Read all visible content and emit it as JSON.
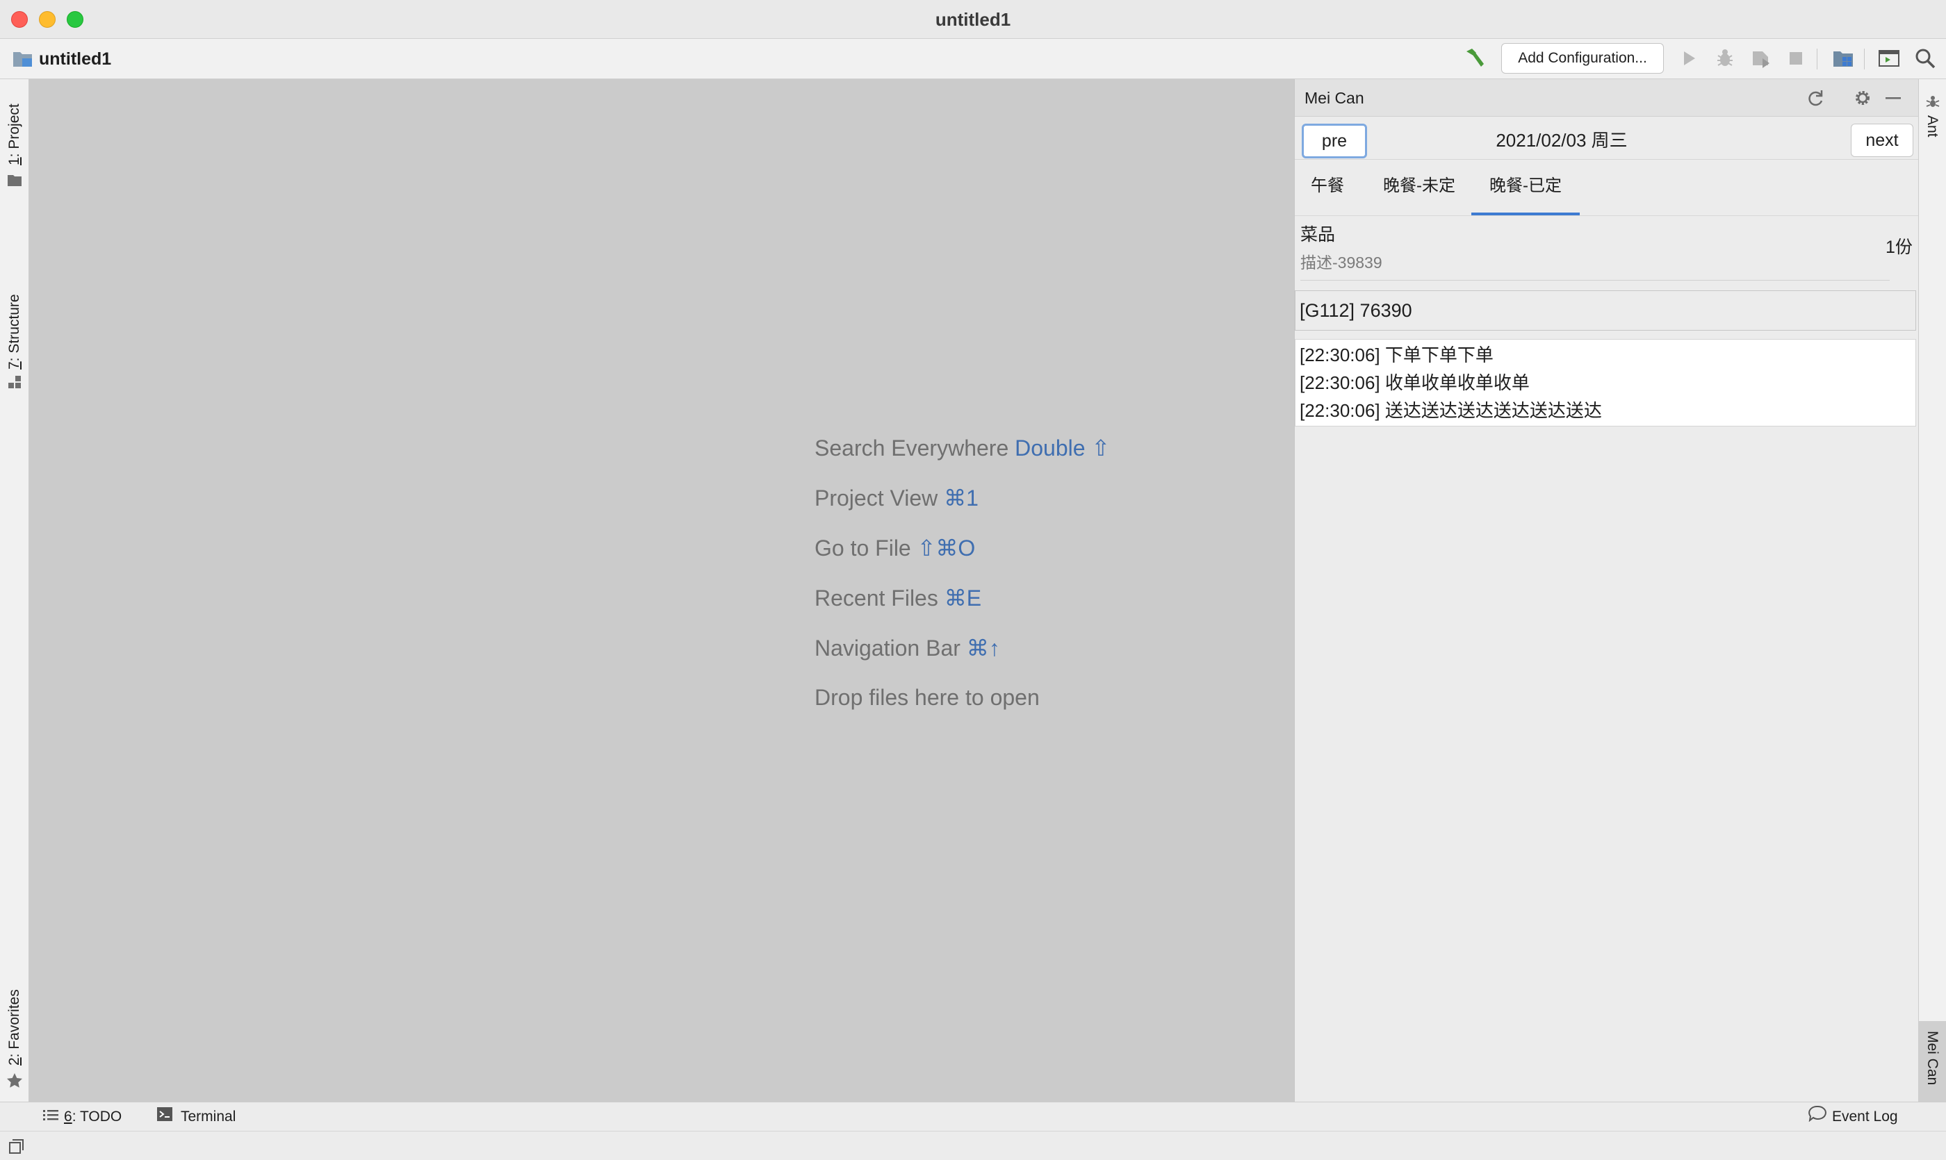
{
  "window": {
    "title": "untitled1"
  },
  "toolbar": {
    "project_name": "untitled1",
    "add_configuration_label": "Add Configuration...",
    "icons": [
      "hammer-icon",
      "run-icon",
      "debug-icon",
      "coverage-icon",
      "stop-icon",
      "project-structure-icon",
      "presentation-icon",
      "search-icon"
    ]
  },
  "left_stripe": {
    "tabs": [
      {
        "mnemonic": "1",
        "label": ": Project"
      },
      {
        "mnemonic": "7",
        "label": ": Structure"
      },
      {
        "mnemonic": "2",
        "label": ": Favorites"
      }
    ]
  },
  "editor": {
    "hints": [
      {
        "text": "Search Everywhere ",
        "shortcut": "Double ⇧"
      },
      {
        "text": "Project View ",
        "shortcut": "⌘1"
      },
      {
        "text": "Go to File ",
        "shortcut": "⇧⌘O"
      },
      {
        "text": "Recent Files ",
        "shortcut": "⌘E"
      },
      {
        "text": "Navigation Bar ",
        "shortcut": "⌘↑"
      },
      {
        "text": "Drop files here to open",
        "shortcut": ""
      }
    ]
  },
  "meican": {
    "title": "Mei Can",
    "pre_label": "pre",
    "date": "2021/02/03 周三",
    "next_label": "next",
    "tabs": [
      "午餐",
      "晚餐-未定",
      "晚餐-已定"
    ],
    "active_tab": 2,
    "dish": {
      "name": "菜品",
      "description": "描述-39839",
      "quantity": "1份"
    },
    "order_code": "[G112] 76390",
    "log": [
      "[22:30:06] 下单下单下单",
      "[22:30:06] 收单收单收单收单",
      "[22:30:06] 送达送达送达送达送达送达"
    ]
  },
  "right_stripe": {
    "tabs": [
      "Ant",
      "Mei Can"
    ]
  },
  "bottom_bar": {
    "todo_mnemonic": "6",
    "todo_label": ": TODO",
    "terminal_label": "Terminal",
    "event_log_label": "Event Log"
  },
  "colors": {
    "editor_bg": "#cbcbcb",
    "accent": "#3d7bd1",
    "hint_key": "#3f6eb0",
    "hammer": "#4a9a3a"
  }
}
